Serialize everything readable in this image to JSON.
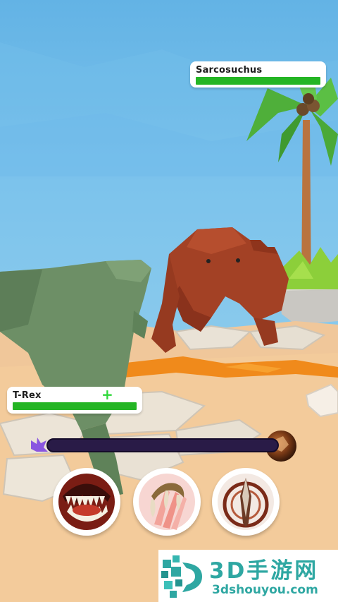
{
  "enemy": {
    "name": "Sarcosuchus",
    "health": 1.0
  },
  "player": {
    "name": "T-Rex",
    "health": 1.0,
    "heal_indicator": "+"
  },
  "rage_meter": {
    "level": 0.0
  },
  "skills": [
    {
      "icon": "bite-jaws-icon"
    },
    {
      "icon": "claw-slash-icon"
    },
    {
      "icon": "tail-spike-icon"
    }
  ],
  "watermark": {
    "title": "3D手游网",
    "url": "3dshouyou.com"
  },
  "colors": {
    "health": "#24b524",
    "rage_track": "#291b47",
    "watermark": "#2ea7a2"
  }
}
